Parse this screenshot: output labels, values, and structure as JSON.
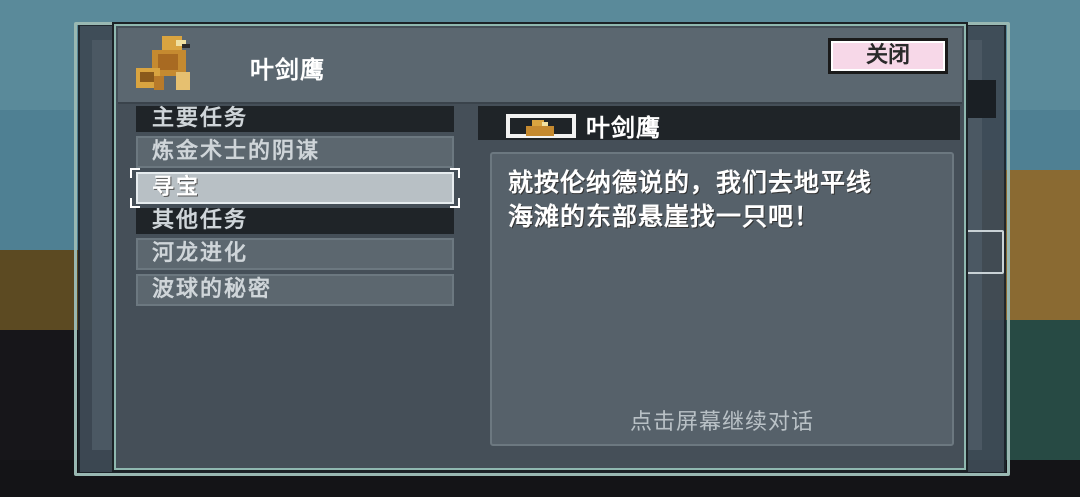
{
  "dialog": {
    "title": "叶剑鹰",
    "close_label": "关闭"
  },
  "quest_list": {
    "main_header": "主要任务",
    "main_items": [
      {
        "label": "炼金术士的阴谋",
        "selected": false
      },
      {
        "label": "寻宝",
        "selected": true
      }
    ],
    "other_header": "其他任务",
    "other_items": [
      {
        "label": "河龙进化",
        "selected": false
      },
      {
        "label": "波球的秘密",
        "selected": false
      }
    ]
  },
  "conversation": {
    "speaker": "叶剑鹰",
    "text_line1": "就按伦纳德说的，我们去地平线",
    "text_line2": "海滩的东部悬崖找一只吧！",
    "continue_hint": "点击屏幕继续对话"
  },
  "icons": {
    "portrait": "bird-portrait-icon",
    "speaker": "speaker-portrait-icon"
  },
  "colors": {
    "close_button_bg": "#f7d8e8",
    "selected_item_bg": "#b8c0c5",
    "frame": "#8fb8b0"
  }
}
